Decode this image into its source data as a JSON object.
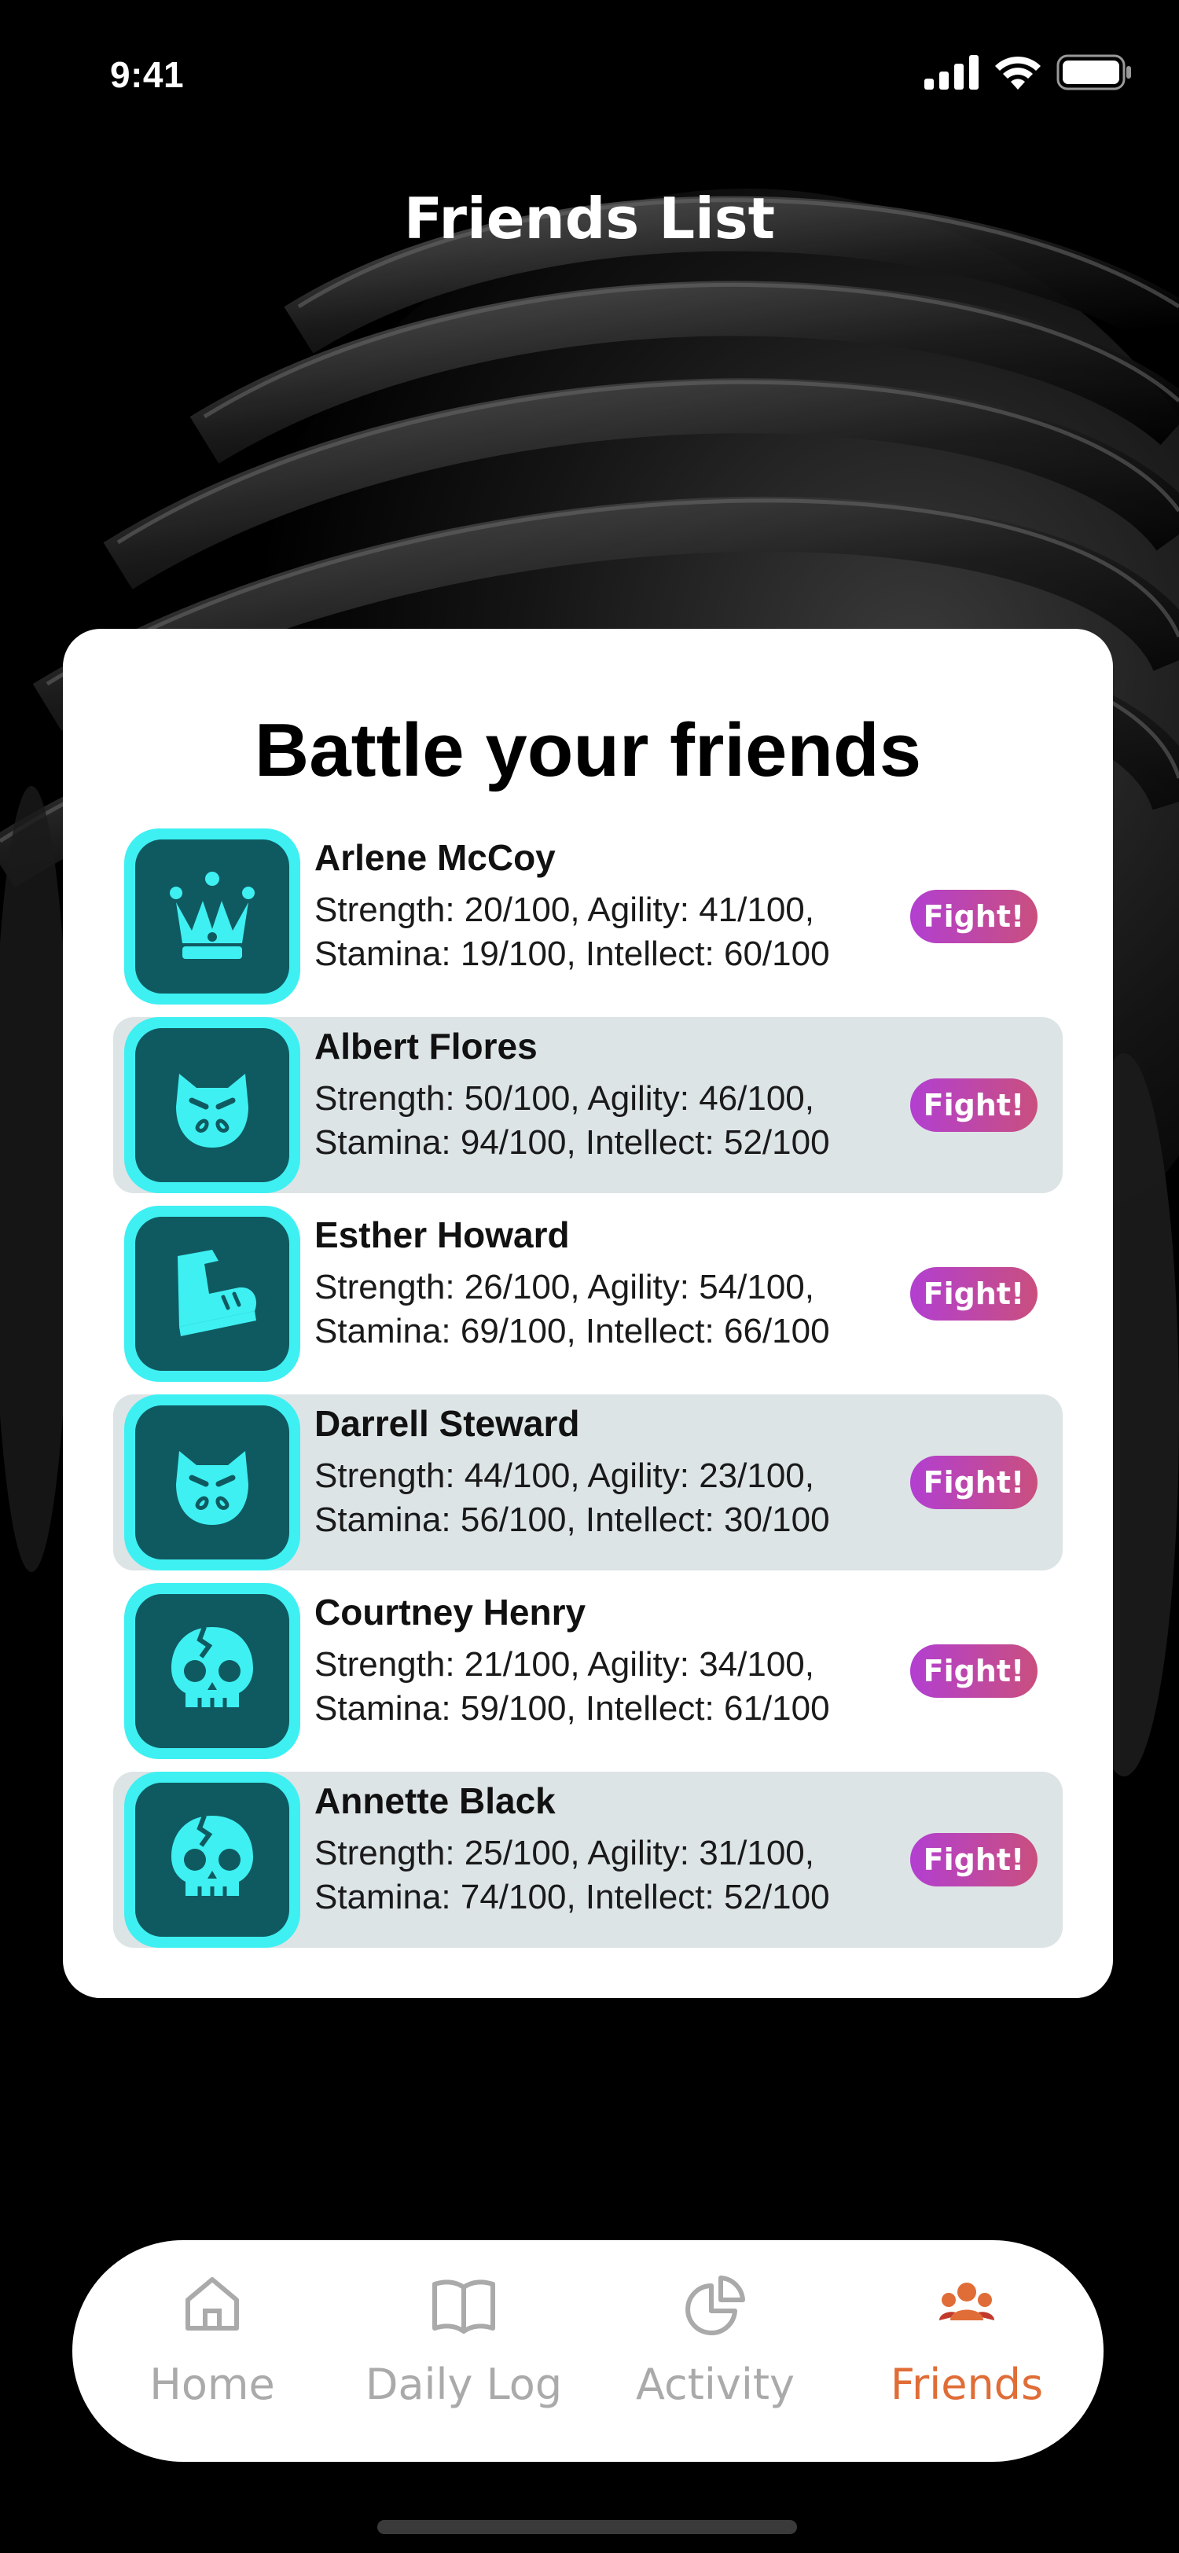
{
  "status_bar": {
    "time": "9:41",
    "icons": [
      "signal-icon",
      "wifi-icon",
      "battery-icon"
    ]
  },
  "header": {
    "title": "Friends List"
  },
  "card": {
    "heading": "Battle your friends",
    "fight_label": "Fight!",
    "friends": [
      {
        "name": "Arlene McCoy",
        "stats_line1": "Strength: 20/100, Agility: 41/100,",
        "stats_line2": "Stamina: 19/100, Intellect: 60/100",
        "icon": "crown-icon"
      },
      {
        "name": "Albert Flores",
        "stats_line1": "Strength: 50/100, Agility: 46/100,",
        "stats_line2": "Stamina: 94/100, Intellect: 52/100",
        "icon": "cat-face-icon"
      },
      {
        "name": "Esther Howard",
        "stats_line1": "Strength: 26/100, Agility: 54/100,",
        "stats_line2": "Stamina: 69/100, Intellect: 66/100",
        "icon": "boot-icon"
      },
      {
        "name": "Darrell Steward",
        "stats_line1": "Strength: 44/100, Agility: 23/100,",
        "stats_line2": "Stamina: 56/100, Intellect: 30/100",
        "icon": "cat-face-icon"
      },
      {
        "name": "Courtney Henry",
        "stats_line1": "Strength: 21/100, Agility: 34/100,",
        "stats_line2": "Stamina: 59/100, Intellect: 61/100",
        "icon": "cracked-skull-icon"
      },
      {
        "name": "Annette Black",
        "stats_line1": "Strength: 25/100, Agility: 31/100,",
        "stats_line2": "Stamina: 74/100, Intellect: 52/100",
        "icon": "cracked-skull-icon"
      }
    ]
  },
  "tabbar": {
    "tabs": [
      {
        "label": "Home",
        "icon": "home-icon",
        "active": false
      },
      {
        "label": "Daily Log",
        "icon": "book-icon",
        "active": false
      },
      {
        "label": "Activity",
        "icon": "pie-chart-icon",
        "active": false
      },
      {
        "label": "Friends",
        "icon": "friends-icon",
        "active": true
      }
    ]
  },
  "colors": {
    "accent": "#e06d37",
    "avatar_border": "#3ef0f2",
    "avatar_fill": "#0f5a60",
    "fight_gradient_start": "#b23fd1",
    "fight_gradient_end": "#c94f7e",
    "row_alt_bg": "#dde4e6"
  }
}
